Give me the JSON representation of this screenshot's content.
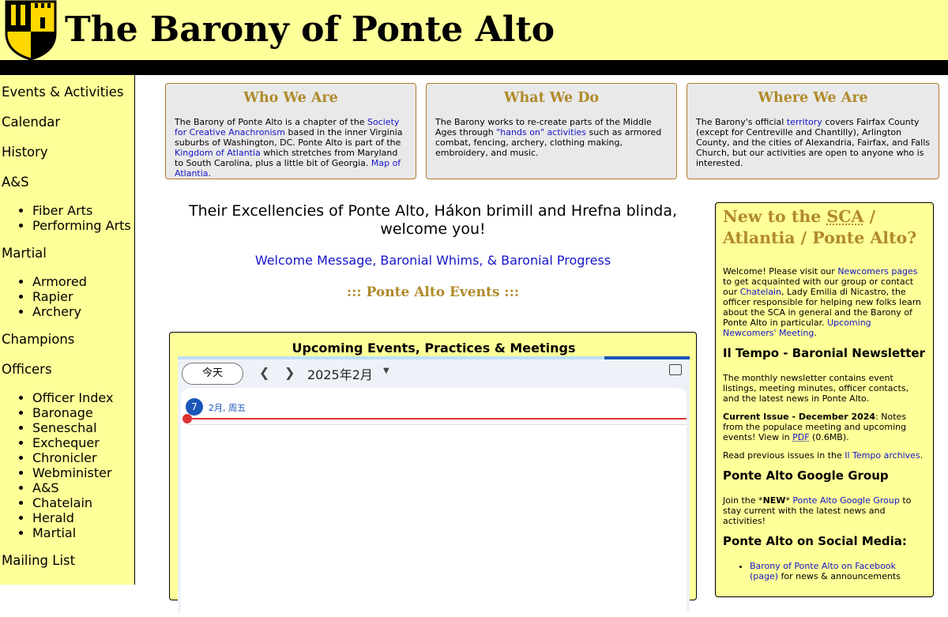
{
  "header": {
    "site_title": "The Barony of Ponte Alto",
    "logo_icon": "barony-shield-icon"
  },
  "sidebar": {
    "items": [
      {
        "label": "Events & Activities"
      },
      {
        "label": "Calendar"
      },
      {
        "label": "History"
      },
      {
        "label": "A&S",
        "children": [
          "Fiber Arts",
          "Performing Arts"
        ]
      },
      {
        "label": "Martial",
        "children": [
          "Armored",
          "Rapier",
          "Archery"
        ]
      },
      {
        "label": "Champions"
      },
      {
        "label": "Officers",
        "children": [
          "Officer Index",
          "Baronage",
          "Seneschal",
          "Exchequer",
          "Chronicler",
          "Webminister",
          "A&S",
          "Chatelain",
          "Herald",
          "Martial"
        ]
      },
      {
        "label": "Mailing List"
      }
    ]
  },
  "info_boxes": {
    "who": {
      "title": "Who We Are",
      "t1": "The Barony of Ponte Alto is a chapter of the ",
      "l1": "Society for Creative Anachronism",
      "t2": " based in the inner Virginia suburbs of Washington, DC.  Ponte Alto is part of the ",
      "l2": "Kingdom of Atlantia",
      "t3": " which stretches from Maryland to South Carolina, plus a little bit of Georgia. ",
      "l3": "Map of Atlantia",
      "t4": "."
    },
    "what": {
      "title": "What We Do",
      "t1": "The Barony works to re-create parts of the Middle Ages through ",
      "l1": "\"hands on\" activities",
      "t2": " such as armored combat, fencing, archery, clothing making, embroidery, and music."
    },
    "where": {
      "title": "Where We Are",
      "t1": "The Barony's official ",
      "l1": "territory",
      "t2": " covers Fairfax County (except for Centreville and Chantilly), Arlington County, and the cities of Alexandria, Fairfax, and Falls Church, but our activities are open to anyone who is interested."
    }
  },
  "main": {
    "welcome": "Their Excellencies of Ponte Alto, Hákon brimill and Hrefna blinda, welcome you!",
    "welcome_links": "Welcome Message, Baronial Whims, & Baronial Progress",
    "events_heading": "::: Ponte Alto Events :::",
    "events_box_title": "Upcoming Events, Practices & Meetings"
  },
  "calendar": {
    "today_button": "今天",
    "prev_icon": "chevron-left-icon",
    "next_icon": "chevron-right-icon",
    "month_label": "2025年2月",
    "dropdown_icon": "caret-down-icon",
    "feedback_icon": "feedback-icon",
    "day_number": "7",
    "day_label": "2月, 周五",
    "accent_color": "#1a56b8",
    "now_color": "#dd3333"
  },
  "right_panel": {
    "title_1": "New to the ",
    "title_abbr": "SCA",
    "title_2": " / Atlantia / Ponte Alto?",
    "intro_t1": "Welcome! Please visit our ",
    "intro_l1": "Newcomers pages",
    "intro_t2": " to get acquainted with our group or contact our ",
    "intro_l2": "Chatelain",
    "intro_t3": ", Lady Emilia di Nicastro, the officer responsible for helping new folks learn about the SCA in general and the Barony of Ponte Alto in particular. ",
    "intro_l3": "Upcoming Newcomers' Meeting",
    "intro_t4": ".",
    "newsletter_heading": "Il Tempo - Baronial Newsletter",
    "newsletter_text": "The monthly newsletter contains event listings, meeting minutes, officer contacts, and the latest news in Ponte Alto.",
    "current_bold": "Current Issue - December 2024",
    "current_t1": ": Notes from the populace meeting and upcoming events! View in ",
    "current_pdf": "PDF",
    "current_t2": " (0.6MB).",
    "archives_t1": "Read previous issues in the ",
    "archives_l1": "Il Tempo archives",
    "archives_t2": ".",
    "group_heading": "Ponte Alto Google Group",
    "group_t1": "Join the *",
    "group_new": "NEW",
    "group_t2": "* ",
    "group_l1": "Ponte Alto Google Group",
    "group_t3": " to stay current with the latest news and activities!",
    "social_heading": "Ponte Alto on Social Media:",
    "social_l1": "Barony of Ponte Alto on Facebook (page)",
    "social_t1": " for news & announcements"
  },
  "colors": {
    "page_yellow": "#ffff99",
    "gold_heading": "#b08a2a",
    "link_blue": "#1515c8",
    "info_box_gray": "#e9e9e9"
  }
}
